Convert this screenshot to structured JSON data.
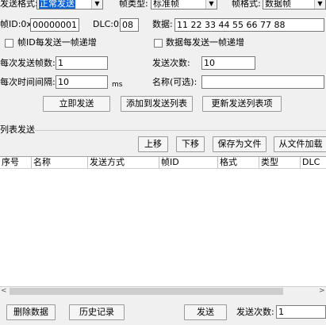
{
  "row1": {
    "send_format_label": "发送格式:",
    "send_format_value": "正常发送",
    "frame_type_label": "帧类型:",
    "frame_type_value": "标准帧",
    "frame_format_label": "帧格式:",
    "frame_format_value": "数据帧"
  },
  "row2": {
    "frame_id_label": "帧ID:0x",
    "frame_id_value": "00000001",
    "dlc_label": "DLC:0x",
    "dlc_value": "08",
    "data_label": "数据:",
    "data_value": "11 22 33 44 55 66 77 88"
  },
  "row3": {
    "id_increment_label": "帧ID每发送一帧递增",
    "data_increment_label": "数据每发送一帧递增"
  },
  "row4": {
    "frames_per_send_label": "每次发送帧数:",
    "frames_per_send_value": "1",
    "send_count_label": "发送次数:",
    "send_count_value": "10"
  },
  "row5": {
    "interval_label": "每次时间间隔:",
    "interval_value": "10",
    "interval_unit": "ms",
    "name_label": "名称(可选):",
    "name_value": ""
  },
  "actions": {
    "send_now": "立即发送",
    "add_to_list": "添加到发送列表",
    "update_list_item": "更新发送列表项"
  },
  "list_section": {
    "title": "列表发送",
    "move_up": "上移",
    "move_down": "下移",
    "save_file": "保存为文件",
    "load_file": "从文件加载",
    "columns": [
      "序号",
      "名称",
      "发送方式",
      "帧ID",
      "格式",
      "类型",
      "DLC"
    ]
  },
  "bottom": {
    "delete_data": "删除数据",
    "history": "历史记录",
    "send": "发送",
    "send_count_label": "发送次数:",
    "send_count_value": "1"
  },
  "colors": {
    "background": "#f0f0f0",
    "selection": "#0a64d8"
  }
}
